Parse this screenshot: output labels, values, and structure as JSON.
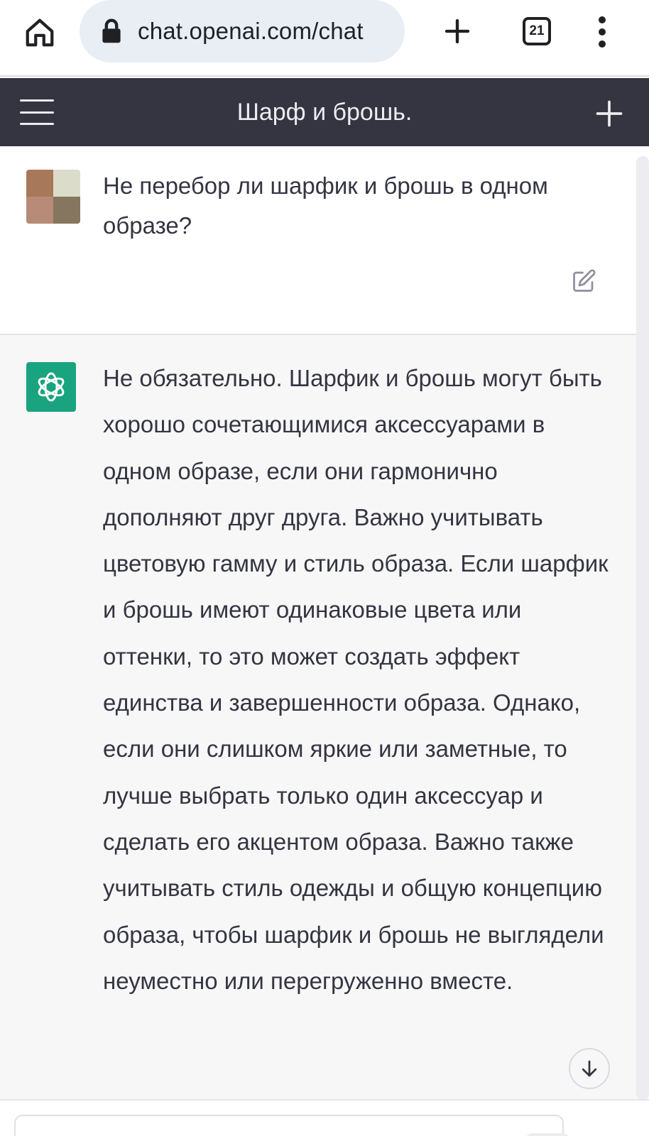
{
  "browser": {
    "url": "chat.openai.com/chat",
    "tab_count": "21",
    "icons": [
      "home-icon",
      "lock-icon",
      "plus-icon",
      "tab-switcher-icon",
      "more-vert-icon"
    ]
  },
  "header": {
    "title": "Шарф и брошь.",
    "icons": [
      "hamburger-icon",
      "plus-icon"
    ]
  },
  "messages": [
    {
      "role": "user",
      "text": "Не перебор ли шарфик и брошь в одном образе?",
      "avatar_colors": [
        "#a8785a",
        "#dcdccb",
        "#b78b77",
        "#867660"
      ]
    },
    {
      "role": "assistant",
      "text": "Не обязательно. Шарфик и брошь могут быть хорошо сочетающимися аксессуарами в одном образе, если они гармонично дополняют друг друга. Важно учитывать цветовую гамму и стиль образа. Если шарфик и брошь имеют одинаковые цвета или оттенки, то это может создать эффект единства и завершенности образа. Однако, если они слишком яркие или заметные, то лучше выбрать только один аксессуар и сделать его акцентом образа. Важно также учитывать стиль одежды и общую концепцию образа, чтобы шарфик и брошь не выглядели неуместно или перегруженно вместе.",
      "avatar_color": "#19a37f"
    }
  ],
  "colors": {
    "header_bg": "#343541",
    "assistant_bg": "#f7f7f8",
    "brand_green": "#19a37f",
    "url_pill_bg": "#e9eef4"
  }
}
